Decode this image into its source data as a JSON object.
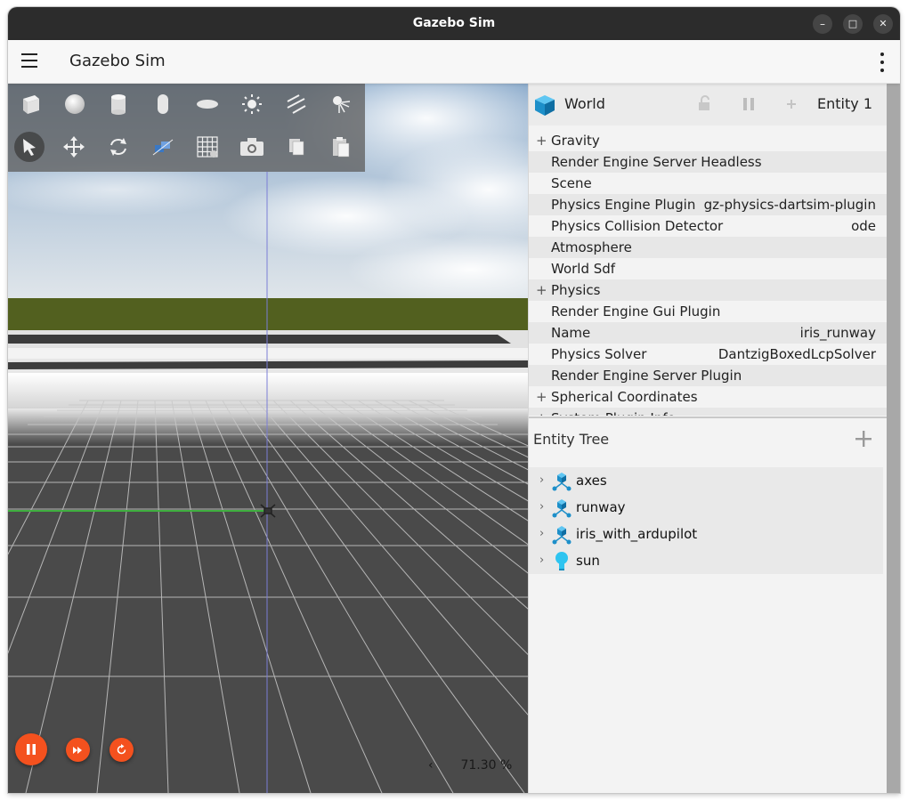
{
  "window": {
    "title": "Gazebo Sim",
    "controls": {
      "minimize": "–",
      "maximize": "□",
      "close": "✕"
    }
  },
  "appbar": {
    "title": "Gazebo Sim",
    "menu_icon": "hamburger-icon",
    "more_icon": "kebab-icon"
  },
  "toolbar": {
    "shapes": [
      "box-icon",
      "sphere-icon",
      "cylinder-icon",
      "capsule-icon",
      "ellipsoid-icon",
      "point-light-icon",
      "directional-light-icon",
      "spot-light-icon"
    ],
    "tools": [
      "select-arrow-icon",
      "translate-icon",
      "rotate-icon",
      "transform-snap-icon",
      "grid-config-icon",
      "screenshot-camera-icon",
      "copy-icon",
      "paste-icon"
    ],
    "active_tool": "select-arrow-icon"
  },
  "playback": {
    "state": "playing",
    "buttons": [
      "pause-icon",
      "step-icon",
      "reset-icon"
    ],
    "rtf_arrow": "‹",
    "rtf_value": "71.30 %"
  },
  "component_inspector": {
    "entity_name": "World",
    "entity_id_label": "Entity 1",
    "header_icons": [
      "lock-icon",
      "pause-icon",
      "add-icon"
    ],
    "rows": [
      {
        "expand": "+",
        "label": "Gravity",
        "value": ""
      },
      {
        "expand": "",
        "label": "Render Engine Server Headless",
        "value": ""
      },
      {
        "expand": "",
        "label": "Scene",
        "value": ""
      },
      {
        "expand": "",
        "label": "Physics Engine Plugin",
        "value": "gz-physics-dartsim-plugin"
      },
      {
        "expand": "",
        "label": "Physics Collision Detector",
        "value": "ode"
      },
      {
        "expand": "",
        "label": "Atmosphere",
        "value": ""
      },
      {
        "expand": "",
        "label": "World Sdf",
        "value": ""
      },
      {
        "expand": "+",
        "label": "Physics",
        "value": ""
      },
      {
        "expand": "",
        "label": "Render Engine Gui Plugin",
        "value": ""
      },
      {
        "expand": "",
        "label": "Name",
        "value": "iris_runway"
      },
      {
        "expand": "",
        "label": "Physics Solver",
        "value": "DantzigBoxedLcpSolver"
      },
      {
        "expand": "",
        "label": "Render Engine Server Plugin",
        "value": ""
      },
      {
        "expand": "+",
        "label": "Spherical Coordinates",
        "value": ""
      },
      {
        "expand": "+",
        "label": "System Plugin Info",
        "value": ""
      }
    ]
  },
  "entity_tree": {
    "title": "Entity Tree",
    "add_icon": "add-icon",
    "items": [
      {
        "label": "axes",
        "icon": "model-icon"
      },
      {
        "label": "runway",
        "icon": "model-icon"
      },
      {
        "label": "iris_with_ardupilot",
        "icon": "model-icon"
      },
      {
        "label": "sun",
        "icon": "light-bulb-icon"
      }
    ]
  },
  "colors": {
    "accent": "#f4511e",
    "titlebar": "#2c2c2c",
    "ground": "#4a4a4a",
    "model_icon": "#1fa3d8"
  }
}
